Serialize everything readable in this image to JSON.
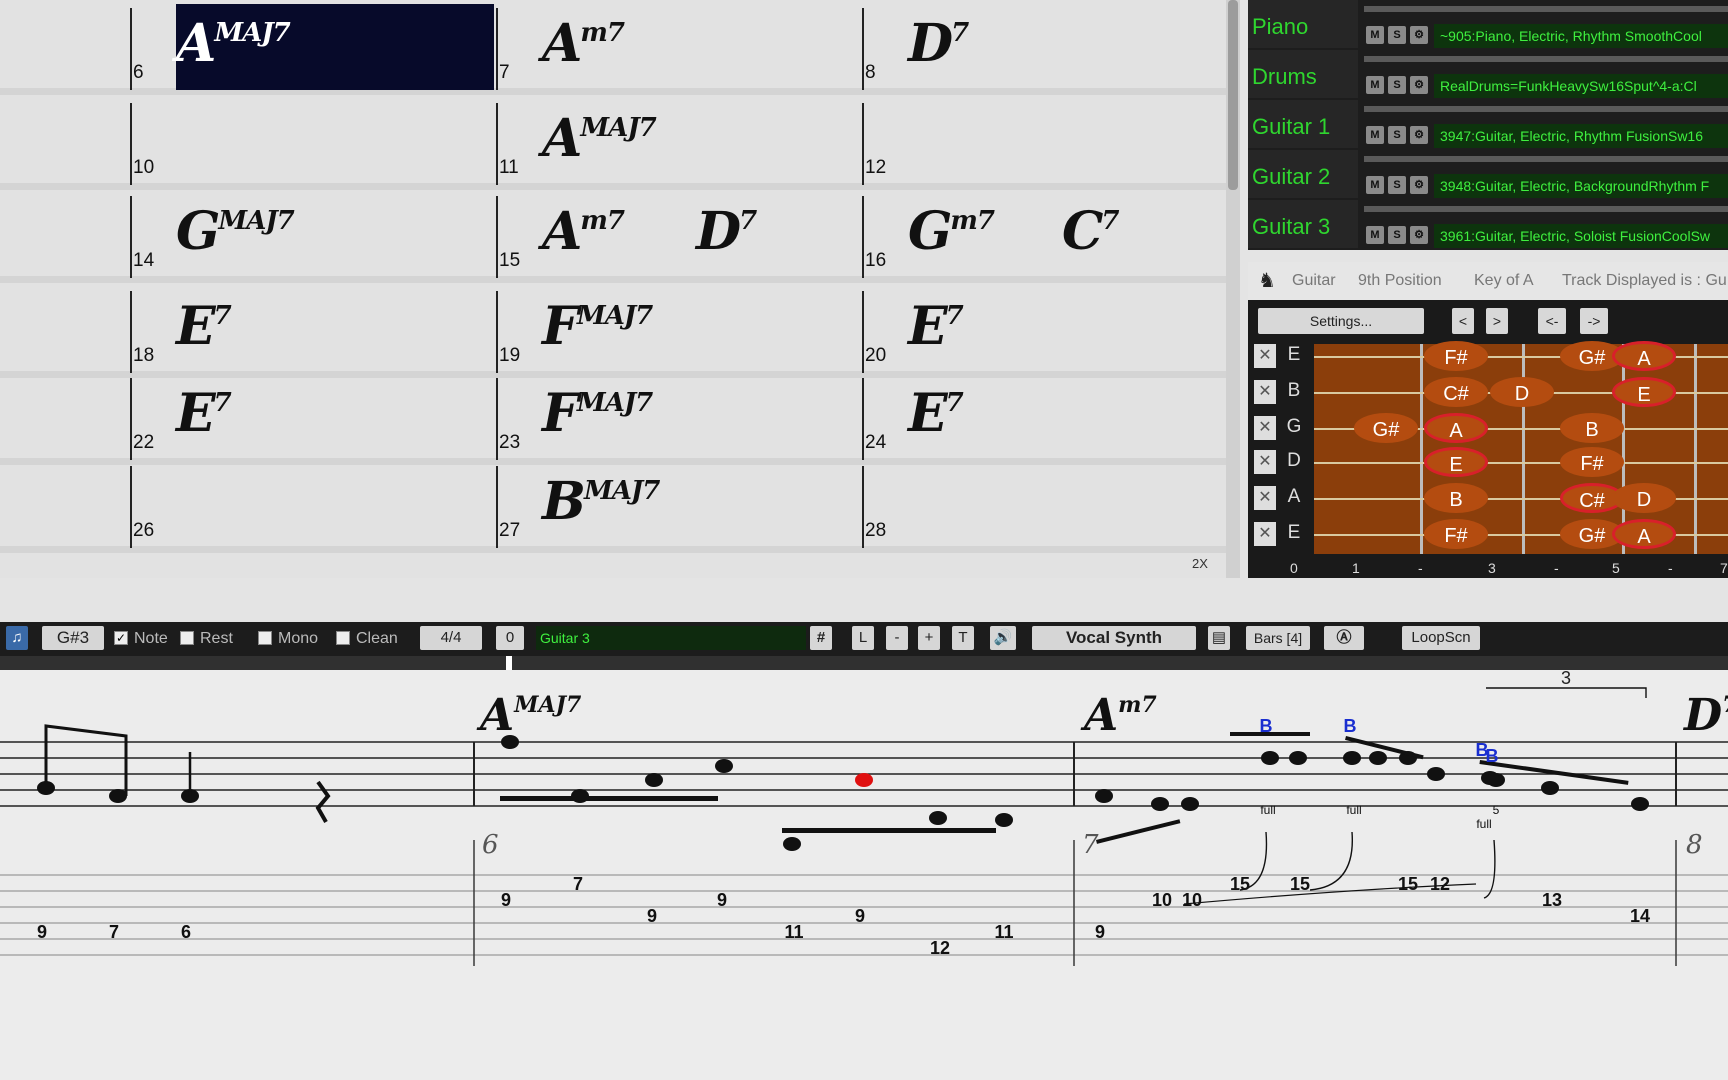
{
  "chord_sheet": {
    "rows": [
      {
        "bars": [
          {
            "num": "6",
            "chords": [
              {
                "root": "A",
                "ext": "MAJ7"
              }
            ],
            "selected": true
          },
          {
            "num": "7",
            "chords": [
              {
                "root": "A",
                "ext": "m7"
              }
            ]
          },
          {
            "num": "8",
            "chords": [
              {
                "root": "D",
                "ext": "7"
              }
            ]
          }
        ]
      },
      {
        "bars": [
          {
            "num": "10",
            "chords": []
          },
          {
            "num": "11",
            "chords": [
              {
                "root": "A",
                "ext": "MAJ7"
              }
            ]
          },
          {
            "num": "12",
            "chords": []
          }
        ]
      },
      {
        "bars": [
          {
            "num": "14",
            "chords": [
              {
                "root": "G",
                "ext": "MAJ7"
              }
            ]
          },
          {
            "num": "15",
            "chords": [
              {
                "root": "A",
                "ext": "m7"
              },
              {
                "root": "D",
                "ext": "7"
              }
            ]
          },
          {
            "num": "16",
            "chords": [
              {
                "root": "G",
                "ext": "m7"
              },
              {
                "root": "C",
                "ext": "7"
              }
            ]
          }
        ]
      },
      {
        "bars": [
          {
            "num": "18",
            "chords": [
              {
                "root": "E",
                "ext": "7"
              }
            ]
          },
          {
            "num": "19",
            "chords": [
              {
                "root": "F",
                "ext": "MAJ7"
              }
            ]
          },
          {
            "num": "20",
            "chords": [
              {
                "root": "E",
                "ext": "7"
              }
            ]
          }
        ]
      },
      {
        "bars": [
          {
            "num": "22",
            "chords": [
              {
                "root": "E",
                "ext": "7"
              }
            ]
          },
          {
            "num": "23",
            "chords": [
              {
                "root": "F",
                "ext": "MAJ7"
              }
            ]
          },
          {
            "num": "24",
            "chords": [
              {
                "root": "E",
                "ext": "7"
              }
            ]
          }
        ]
      },
      {
        "bars": [
          {
            "num": "26",
            "chords": []
          },
          {
            "num": "27",
            "chords": [
              {
                "root": "B",
                "ext": "MAJ7"
              }
            ]
          },
          {
            "num": "28",
            "chords": []
          }
        ]
      }
    ],
    "zoom_label": "2X"
  },
  "tracks": [
    {
      "name": "Piano",
      "patch": "~905:Piano, Electric, Rhythm SmoothCool"
    },
    {
      "name": "Drums",
      "patch": "RealDrums=FunkHeavySw16Sput^4-a:Cl"
    },
    {
      "name": "Guitar 1",
      "patch": "3947:Guitar, Electric, Rhythm FusionSw16"
    },
    {
      "name": "Guitar 2",
      "patch": "3948:Guitar, Electric, BackgroundRhythm F"
    },
    {
      "name": "Guitar 3",
      "patch": "3961:Guitar, Electric, Soloist FusionCoolSw"
    }
  ],
  "track_buttons": [
    "M",
    "S"
  ],
  "guitar": {
    "title": "Guitar",
    "position": "9th Position",
    "key": "Key of A",
    "track_displayed": "Track Displayed is : Gu",
    "settings_label": "Settings...",
    "nav_buttons": [
      "<",
      ">",
      "<-",
      "->"
    ],
    "strings": [
      "E",
      "B",
      "G",
      "D",
      "A",
      "E"
    ],
    "close_glyph": "✕",
    "fret_labels": [
      "0",
      "1",
      "-",
      "3",
      "-",
      "5",
      "-",
      "7"
    ],
    "notes": [
      {
        "s": 0,
        "f": 1,
        "n": "F#",
        "root": false
      },
      {
        "s": 0,
        "f": 3,
        "n": "G#",
        "root": false
      },
      {
        "s": 0,
        "f": 4,
        "n": "A",
        "root": true
      },
      {
        "s": 1,
        "f": 1,
        "n": "C#",
        "root": false
      },
      {
        "s": 1,
        "f": 2,
        "n": "D",
        "root": false
      },
      {
        "s": 1,
        "f": 4,
        "n": "E",
        "root": true
      },
      {
        "s": 2,
        "f": 0,
        "n": "G#",
        "root": false
      },
      {
        "s": 2,
        "f": 1,
        "n": "A",
        "root": true
      },
      {
        "s": 2,
        "f": 3,
        "n": "B",
        "root": false
      },
      {
        "s": 3,
        "f": 1,
        "n": "E",
        "root": true
      },
      {
        "s": 3,
        "f": 3,
        "n": "F#",
        "root": false
      },
      {
        "s": 4,
        "f": 1,
        "n": "B",
        "root": false
      },
      {
        "s": 4,
        "f": 3,
        "n": "C#",
        "root": true
      },
      {
        "s": 4,
        "f": 4,
        "n": "D",
        "root": false
      },
      {
        "s": 5,
        "f": 1,
        "n": "F#",
        "root": false
      },
      {
        "s": 5,
        "f": 3,
        "n": "G#",
        "root": false
      },
      {
        "s": 5,
        "f": 4,
        "n": "A",
        "root": true
      }
    ]
  },
  "notation_toolbar": {
    "note_value": "G#3",
    "note_label": "Note",
    "rest_label": "Rest",
    "mono_label": "Mono",
    "clean_label": "Clean",
    "time_sig": "4/4",
    "offset": "0",
    "track": "Guitar 3",
    "sharp": "#",
    "btn_L": "L",
    "btn_minus": "-",
    "btn_plus": "+",
    "btn_T": "T",
    "vocal_synth": "Vocal Synth",
    "bars": "Bars [4]",
    "loopscn": "LoopScn",
    "note_checked": true
  },
  "notation": {
    "chords": [
      {
        "root": "A",
        "ext": "MAJ7"
      },
      {
        "root": "A",
        "ext": "m7"
      },
      {
        "root": "D",
        "ext": "7"
      }
    ],
    "bar_numbers": [
      "6",
      "7",
      "8"
    ],
    "tuplet": "3",
    "bend_labels": [
      "full",
      "full",
      "full",
      "5"
    ],
    "note_names": [
      "B",
      "B",
      "B",
      "B"
    ],
    "tab_numbers": [
      "9",
      "7",
      "6",
      "9",
      "7",
      "9",
      "9",
      "11",
      "9",
      "12",
      "11",
      "9",
      "10",
      "10",
      "15",
      "15",
      "15",
      "12",
      "13",
      "14"
    ]
  }
}
